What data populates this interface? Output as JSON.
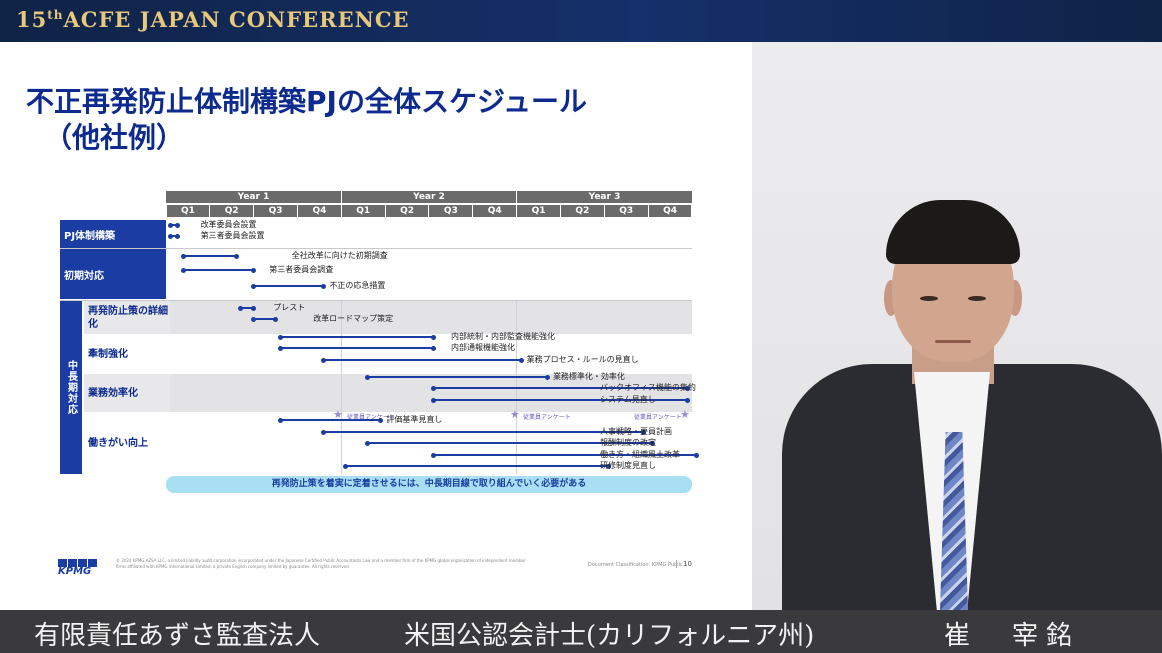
{
  "banner": {
    "num": "15",
    "sup": "th",
    "title": "ACFE JAPAN CONFERENCE"
  },
  "slide": {
    "title_line1": "不正再発防止体制構築PJの全体スケジュール",
    "title_line2": "（他社例）",
    "years": [
      "Year 1",
      "Year 2",
      "Year 3"
    ],
    "quarters": [
      "Q1",
      "Q2",
      "Q3",
      "Q4",
      "Q1",
      "Q2",
      "Q3",
      "Q4",
      "Q1",
      "Q2",
      "Q3",
      "Q4"
    ],
    "categories": [
      "PJ体制構築",
      "初期対応"
    ],
    "mid_long_title": "中長期対応",
    "sub_categories": [
      "再発防止策の詳細化",
      "牽制強化",
      "業務効率化",
      "働きがい向上"
    ],
    "bars": [
      {
        "label": "改革委員会設置",
        "start": 0,
        "end": 0.15
      },
      {
        "label": "第三者委員会設置",
        "start": 0,
        "end": 0.15
      },
      {
        "label": "全社改革に向けた初期調査",
        "start": 0.3,
        "end": 1.5
      },
      {
        "label": "第三者委員会調査",
        "start": 0.3,
        "end": 1.9
      },
      {
        "label": "不正の応急措置",
        "start": 1.9,
        "end": 3.5
      },
      {
        "label": "プレスト",
        "start": 1.6,
        "end": 1.9
      },
      {
        "label": "改革ロードマップ策定",
        "start": 1.9,
        "end": 2.4
      },
      {
        "label": "内部統制・内部監査機能強化",
        "start": 2.5,
        "end": 6.0
      },
      {
        "label": "内部通報機能強化",
        "start": 2.5,
        "end": 6.0
      },
      {
        "label": "業務プロセス・ルールの見直し",
        "start": 3.5,
        "end": 8.0
      },
      {
        "label": "業務標準化・効率化",
        "start": 4.5,
        "end": 8.6
      },
      {
        "label": "バックオフィス機能の集約",
        "start": 6.0,
        "end": 11.8
      },
      {
        "label": "システム見直し",
        "start": 6.0,
        "end": 11.8
      },
      {
        "label": "評価基準見直し",
        "start": 2.5,
        "end": 4.8
      },
      {
        "label": "人事戦略・要員計画",
        "start": 3.5,
        "end": 10.8
      },
      {
        "label": "報酬制度の改定",
        "start": 4.5,
        "end": 11.0
      },
      {
        "label": "働き方・組織風土改革",
        "start": 6.0,
        "end": 12.0
      },
      {
        "label": "研修制度見直し",
        "start": 4.0,
        "end": 10.0
      }
    ],
    "survey_label": "従業員アンケート",
    "conclusion": "再発防止策を着実に定着させるには、中長期目線で取り組んでいく必要がある",
    "logo": "KPMG",
    "copyright": "© 2024 KPMG AZSA LLC, a limited liability audit corporation incorporated under the Japanese Certified Public Accountants Law and a member firm of the KPMG global organization of independent member firms affiliated with KPMG International Limited, a private English company limited by guarantee. All rights reserved.",
    "doc_class": "Document Classification: KPMG Public",
    "page": "10"
  },
  "caption": {
    "org": "有限責任あずさ監査法人",
    "qual": "米国公認会計士(カリフォルニア州)",
    "name": "崔　宰銘"
  },
  "colors": {
    "accent": "#1b3da3",
    "banner": "#15306a",
    "gold": "#e7c87d"
  }
}
